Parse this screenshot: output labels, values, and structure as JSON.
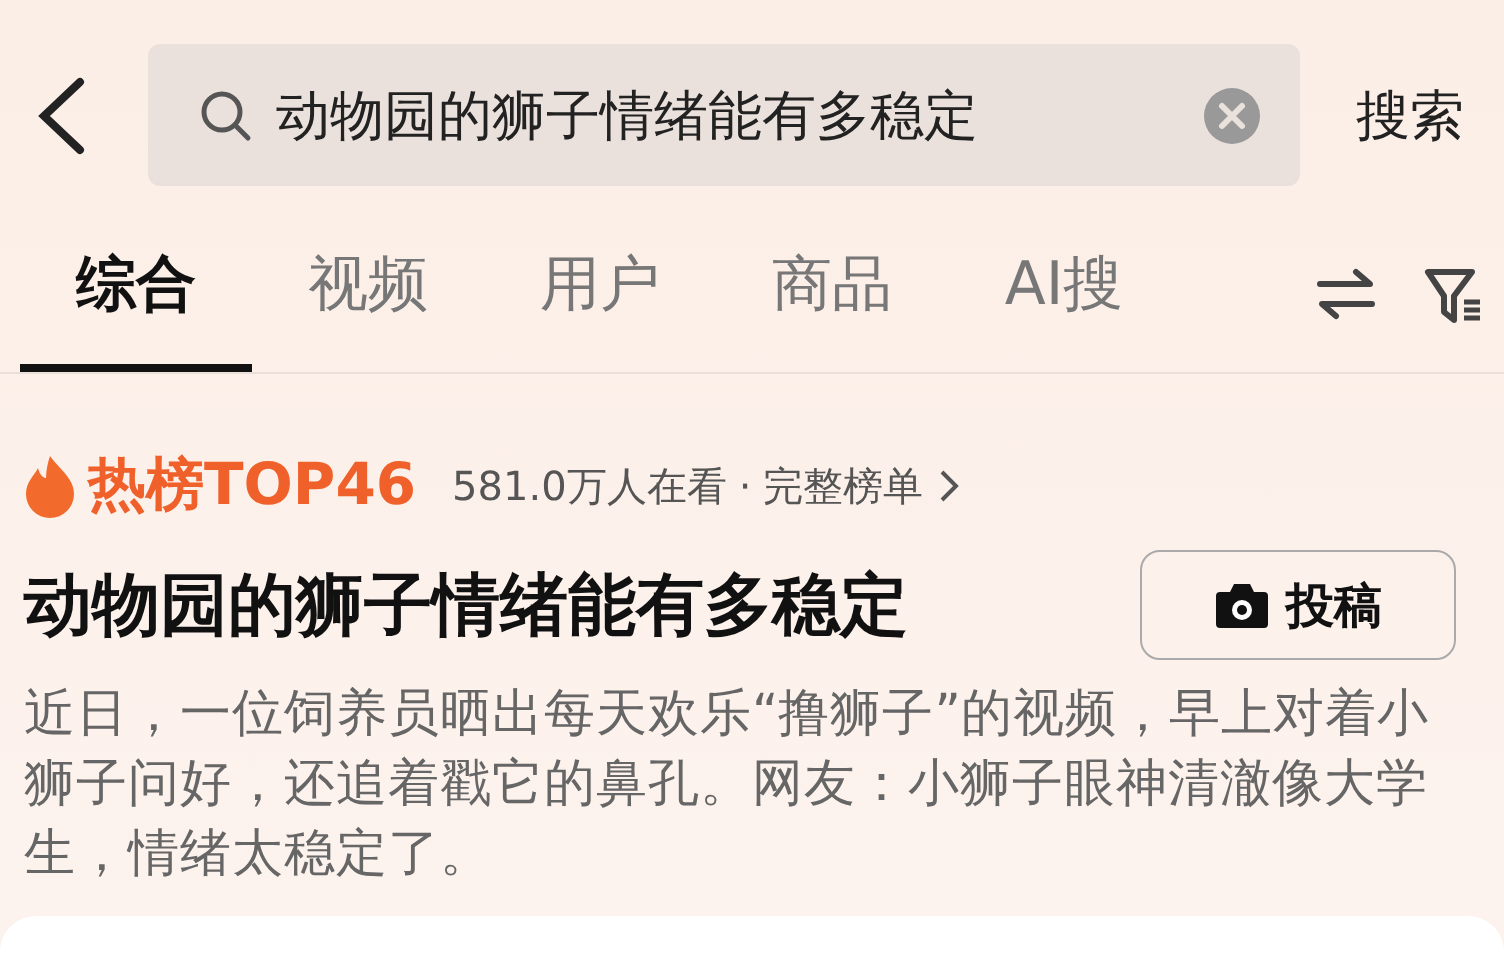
{
  "search": {
    "value": "动物园的狮子情绪能有多稳定",
    "action": "搜索"
  },
  "tabs": [
    {
      "label": "综合",
      "selected": true
    },
    {
      "label": "视频",
      "selected": false
    },
    {
      "label": "用户",
      "selected": false
    },
    {
      "label": "商品",
      "selected": false
    },
    {
      "label": "AI搜",
      "selected": false
    }
  ],
  "hot": {
    "rank": "热榜TOP46",
    "viewers": "581.0万人在看",
    "separator": "·",
    "link": "完整榜单"
  },
  "topic": {
    "title": "动物园的狮子情绪能有多稳定",
    "button": "投稿",
    "description": "近日，一位饲养员晒出每天欢乐“撸狮子”的视频，早上对着小狮子问好，还追着戳它的鼻孔。网友：小狮子眼神清澈像大学生，情绪太稳定了。"
  }
}
